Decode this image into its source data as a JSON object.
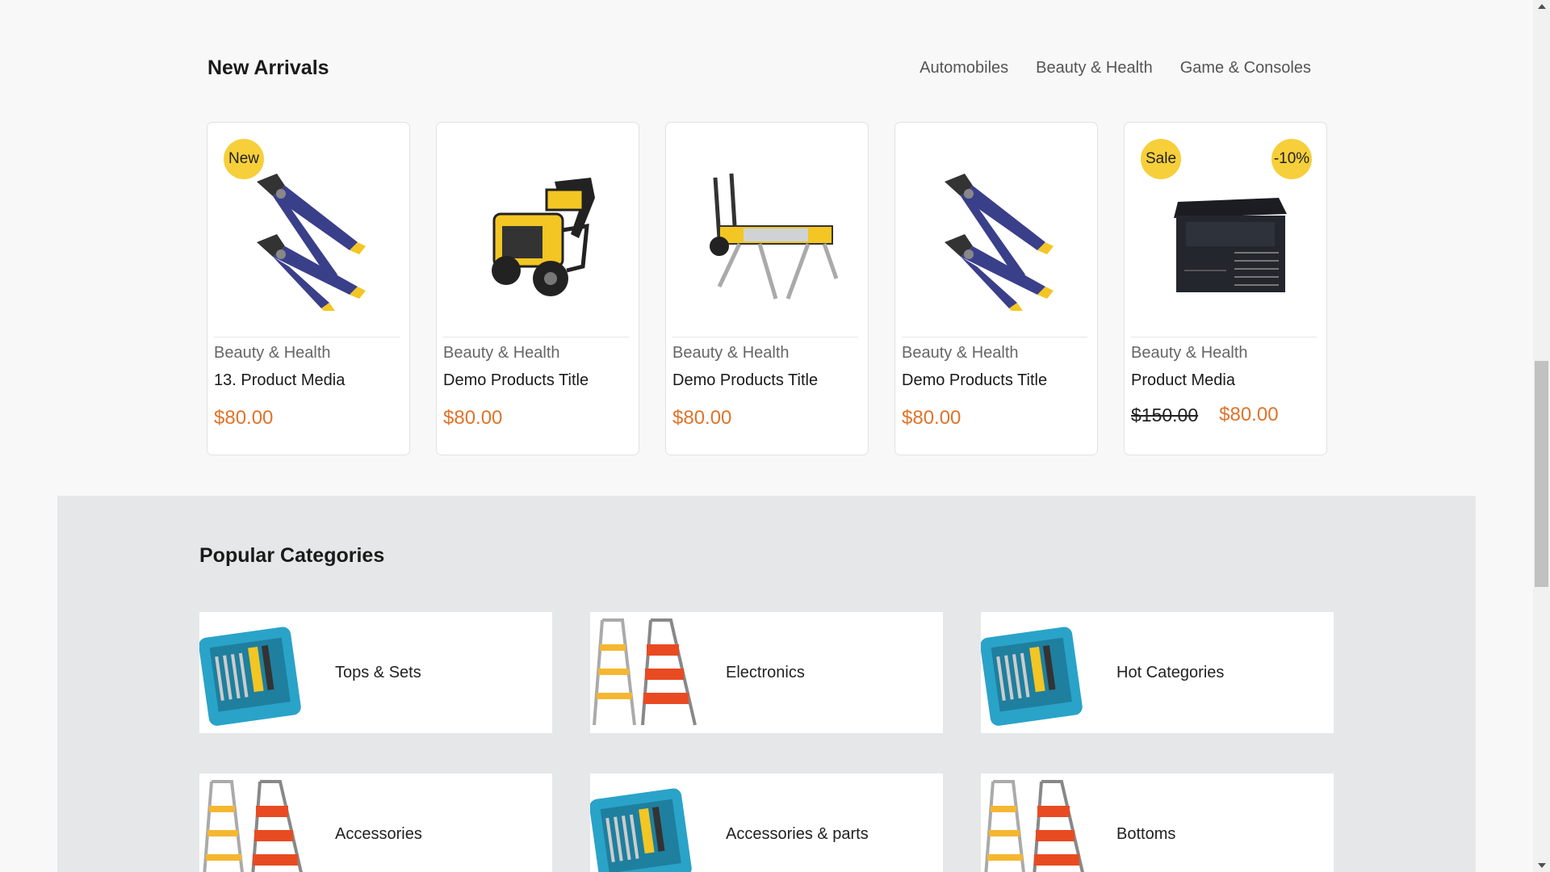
{
  "new_arrivals": {
    "title": "New Arrivals",
    "tabs": [
      "Automobiles",
      "Beauty & Health",
      "Game & Consoles"
    ],
    "products": [
      {
        "badge_left": "New",
        "badge_right": "",
        "category": "Beauty & Health",
        "title": "13. Product Media",
        "old_price": "",
        "price": "$80.00",
        "image": "pliers-icon"
      },
      {
        "badge_left": "",
        "badge_right": "",
        "category": "Beauty & Health",
        "title": "Demo Products Title",
        "old_price": "",
        "price": "$80.00",
        "image": "pressure-washer-icon"
      },
      {
        "badge_left": "",
        "badge_right": "",
        "category": "Beauty & Health",
        "title": "Demo Products Title",
        "old_price": "",
        "price": "$80.00",
        "image": "work-stand-icon"
      },
      {
        "badge_left": "",
        "badge_right": "",
        "category": "Beauty & Health",
        "title": "Demo Products Title",
        "old_price": "",
        "price": "$80.00",
        "image": "pliers-icon"
      },
      {
        "badge_left": "Sale",
        "badge_right": "-10%",
        "category": "Beauty & Health",
        "title": "Product Media",
        "old_price": "$150.00",
        "price": "$80.00",
        "image": "tool-chest-icon"
      }
    ]
  },
  "popular_categories": {
    "title": "Popular Categories",
    "items": [
      {
        "label": "Tops & Sets",
        "image": "toolbox-icon"
      },
      {
        "label": "Electronics",
        "image": "step-ladder-icon"
      },
      {
        "label": "Hot Categories",
        "image": "toolbox-icon"
      },
      {
        "label": "Accessories",
        "image": "step-ladder-icon"
      },
      {
        "label": "Accessories & parts",
        "image": "toolbox-icon"
      },
      {
        "label": "Bottoms",
        "image": "step-ladder-icon"
      }
    ]
  },
  "colors": {
    "price": "#e0742a",
    "badge": "#f6cf3a",
    "section_bg": "#e6e7e8"
  }
}
